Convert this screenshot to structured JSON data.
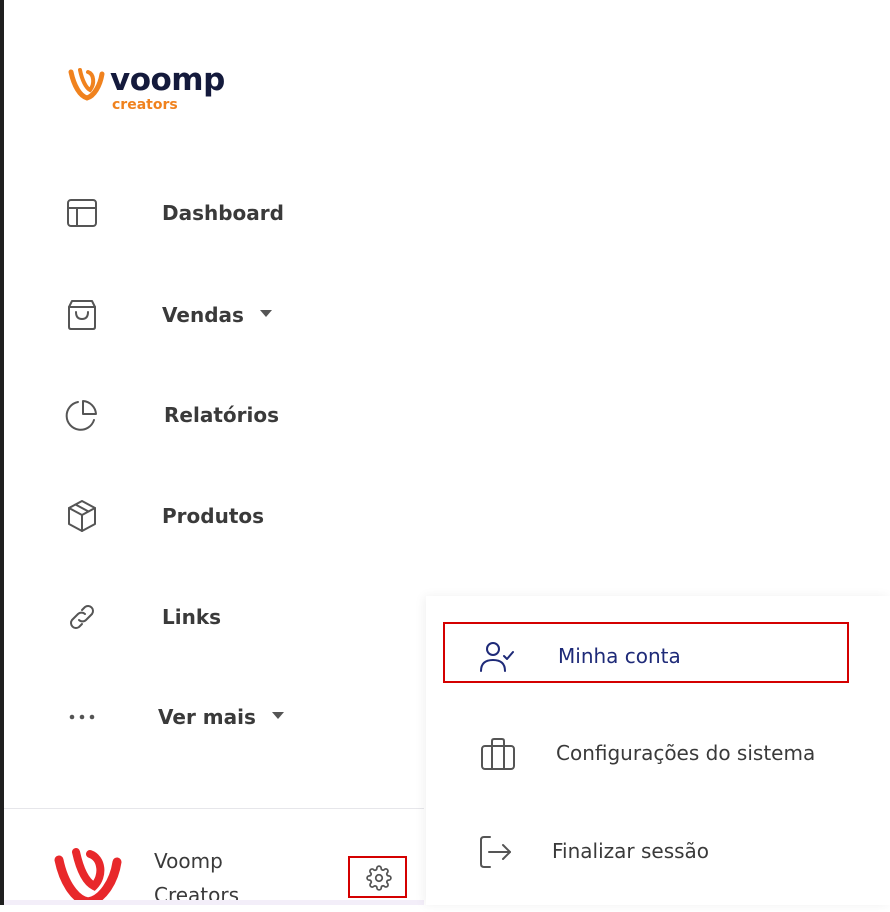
{
  "brand": {
    "name": "voomp",
    "tagline": "creators",
    "wordmark_color": "#141a3c",
    "accent_color": "#f0821e"
  },
  "nav": {
    "items": [
      {
        "label": "Dashboard",
        "icon": "layout-icon",
        "has_dropdown": false
      },
      {
        "label": "Vendas",
        "icon": "shopping-bag-icon",
        "has_dropdown": true
      },
      {
        "label": "Relatórios",
        "icon": "pie-chart-icon",
        "has_dropdown": false
      },
      {
        "label": "Produtos",
        "icon": "package-icon",
        "has_dropdown": false
      },
      {
        "label": "Links",
        "icon": "link-icon",
        "has_dropdown": false
      },
      {
        "label": "Ver mais",
        "icon": "more-horizontal-icon",
        "has_dropdown": true
      }
    ]
  },
  "profile": {
    "name_line1": "Voomp",
    "name_line2": "Creators",
    "avatar_icon": "voomp-logo-icon",
    "settings_icon": "gear-icon"
  },
  "settings_menu": {
    "items": [
      {
        "label": "Minha conta",
        "icon": "user-check-icon",
        "highlighted": true
      },
      {
        "label": "Configurações do sistema",
        "icon": "briefcase-icon",
        "highlighted": false
      },
      {
        "label": "Finalizar sessão",
        "icon": "log-out-icon",
        "highlighted": false
      }
    ]
  },
  "colors": {
    "text": "#3a3a3a",
    "active_menu_text": "#1e2a78",
    "highlight_border": "#d40000",
    "avatar_red": "#e8282b"
  }
}
